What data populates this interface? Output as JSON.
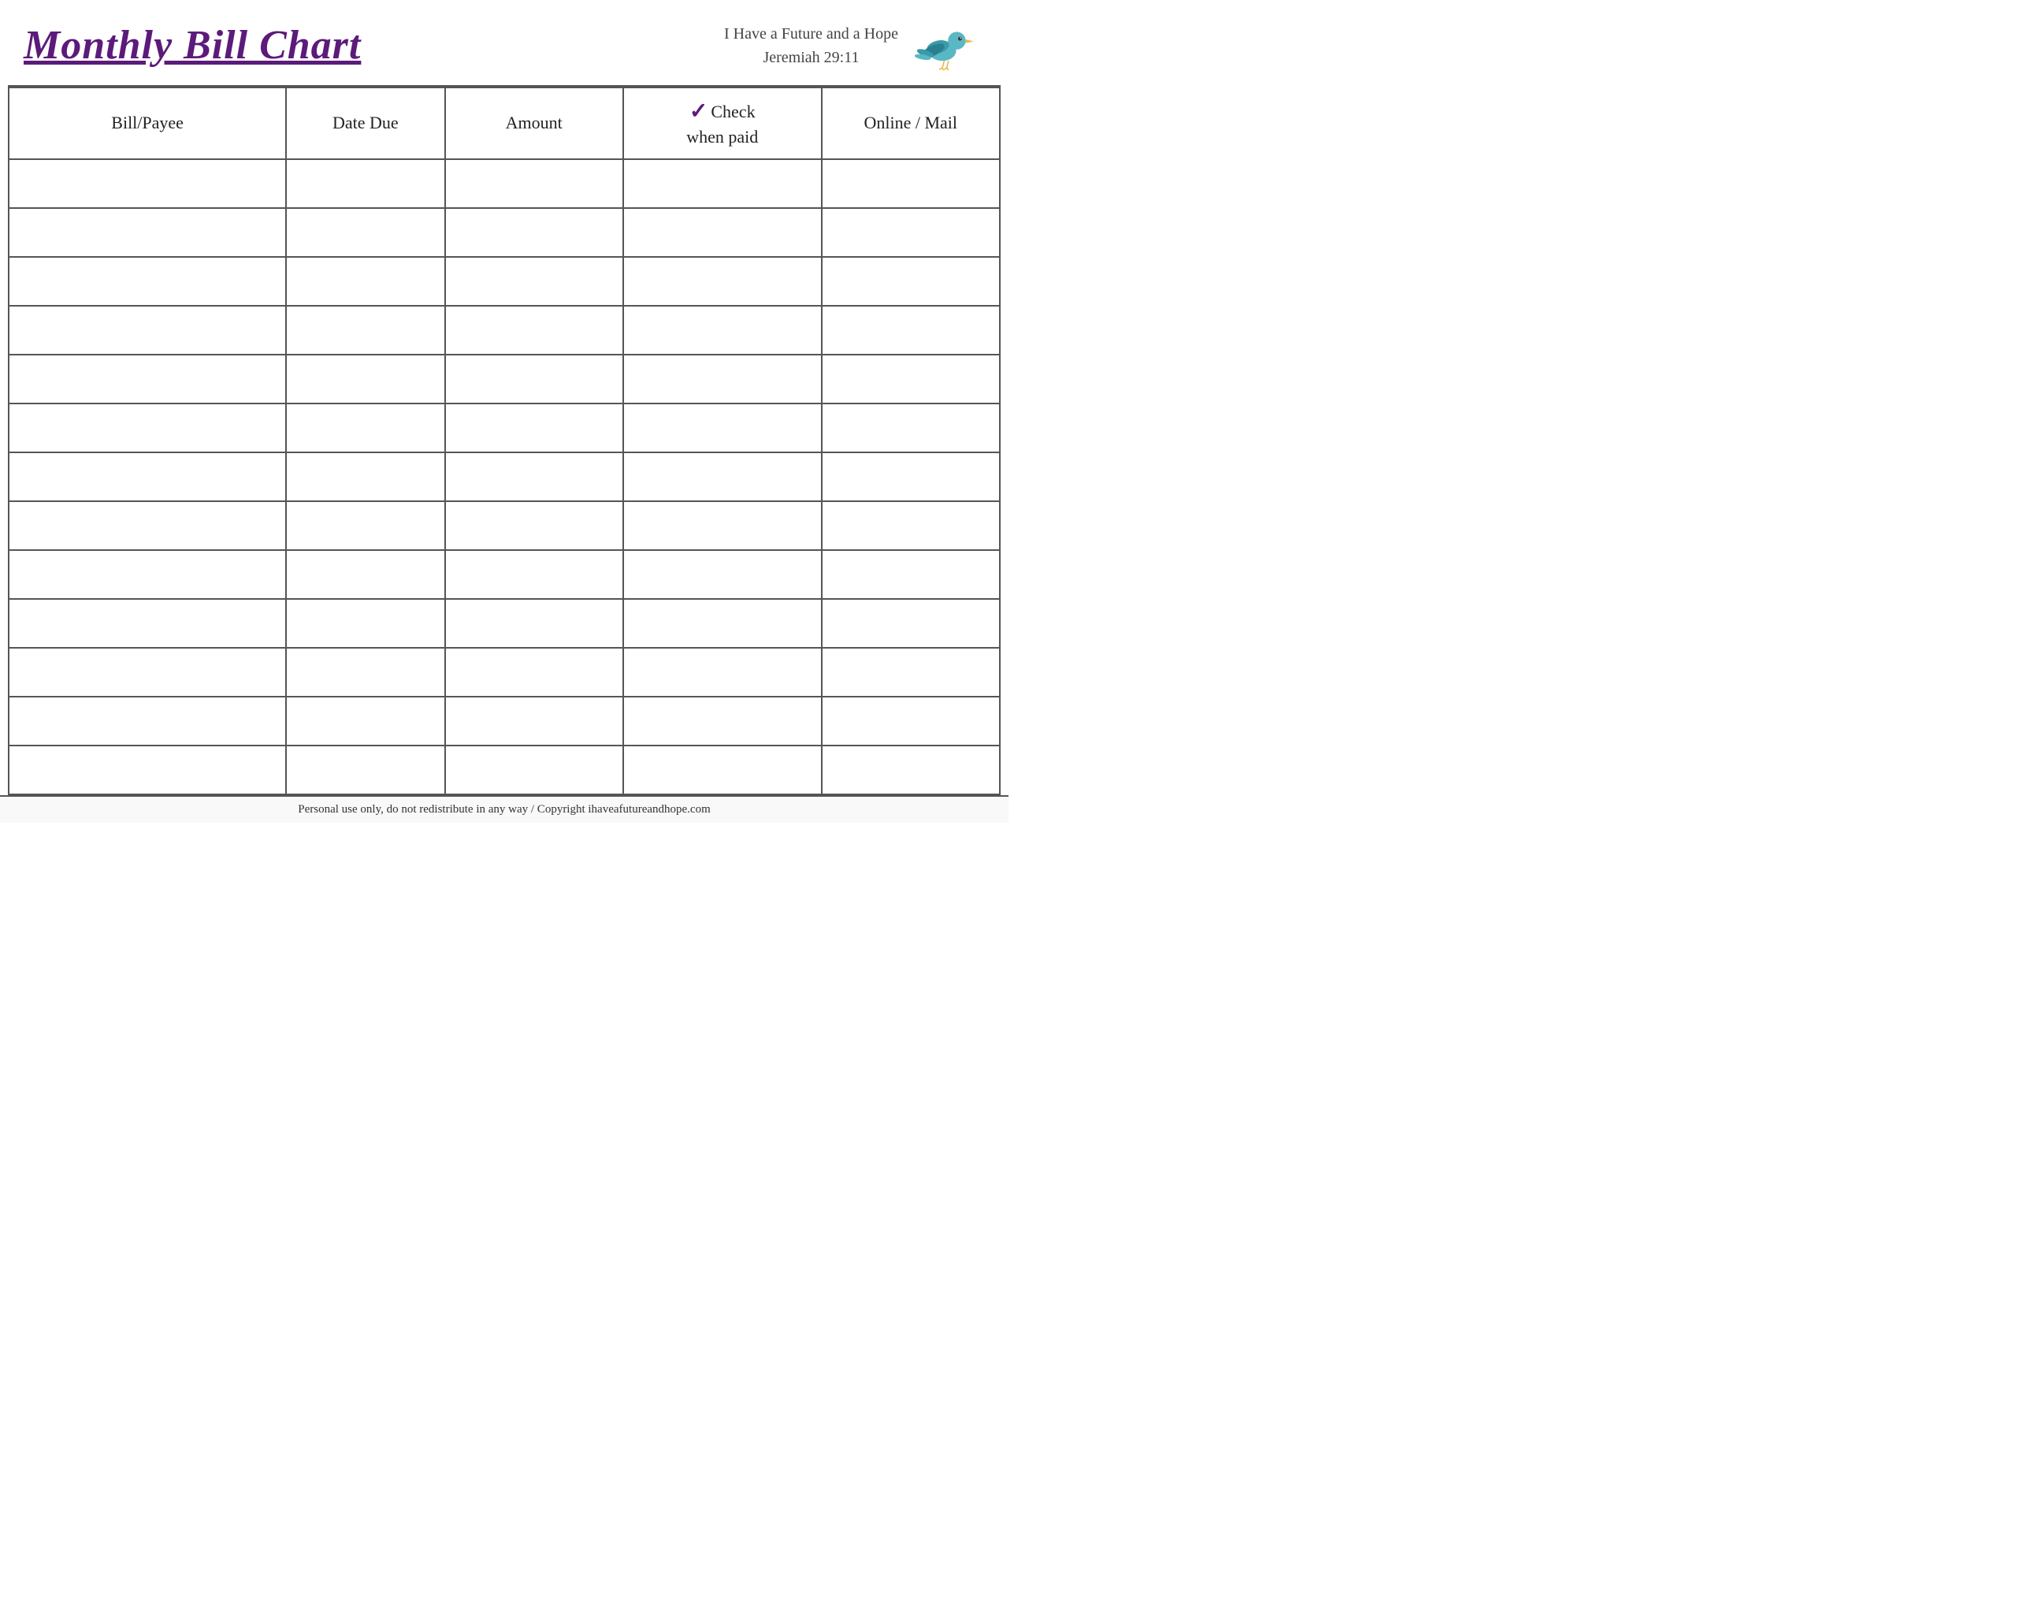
{
  "header": {
    "title": "Monthly Bill Chart",
    "scripture_line1": "I Have a Future and a Hope",
    "scripture_line2": "Jeremiah 29:11"
  },
  "columns": [
    {
      "label": "Bill/Payee",
      "id": "bill-payee"
    },
    {
      "label": "Date Due",
      "id": "date-due"
    },
    {
      "label": "Amount",
      "id": "amount"
    },
    {
      "label_check": "Check",
      "label_when": "when paid",
      "id": "check-when-paid"
    },
    {
      "label": "Online / Mail",
      "id": "online-mail"
    }
  ],
  "row_count": 13,
  "footer": {
    "text": "Personal use only, do not redistribute in any way / Copyright ihaveafutureandhope.com"
  },
  "colors": {
    "title": "#5c1a7a",
    "checkmark": "#5c1a7a",
    "border": "#555"
  }
}
